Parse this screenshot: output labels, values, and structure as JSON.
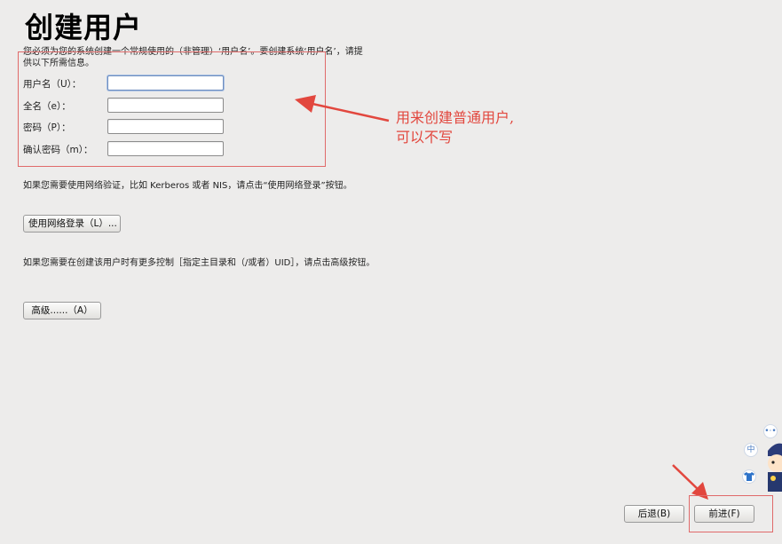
{
  "title": "创建用户",
  "intro": "您必须为您的系统创建一个常规使用的（非管理）‘用户名’。要创建系统‘用户名’，请提供以下所需信息。",
  "form": {
    "username_label": "用户名（U）：",
    "username_value": "",
    "fullname_label": "全名（e）：",
    "fullname_value": "",
    "password_label": "密码（P）：",
    "password_value": "",
    "confirm_label": "确认密码（m）：",
    "confirm_value": ""
  },
  "network_note": "如果您需要使用网络验证，比如 Kerberos 或者 NIS，请点击“使用网络登录”按钮。",
  "network_button": "使用网络登录（L）...",
  "advanced_note": "如果您需要在创建该用户时有更多控制［指定主目录和（/或者）UID］，请点击高级按钮。",
  "advanced_button": "高级......（A）",
  "nav": {
    "back": "后退(B)",
    "forward": "前进(F)"
  },
  "annotation": {
    "line1": "用来创建普通用户,",
    "line2": "可以不写",
    "color": "#e2473e"
  },
  "floating": {
    "dots": "•·•",
    "zh": "中"
  },
  "colors": {
    "background": "#edeceb",
    "annotation_red": "#e2473e"
  }
}
